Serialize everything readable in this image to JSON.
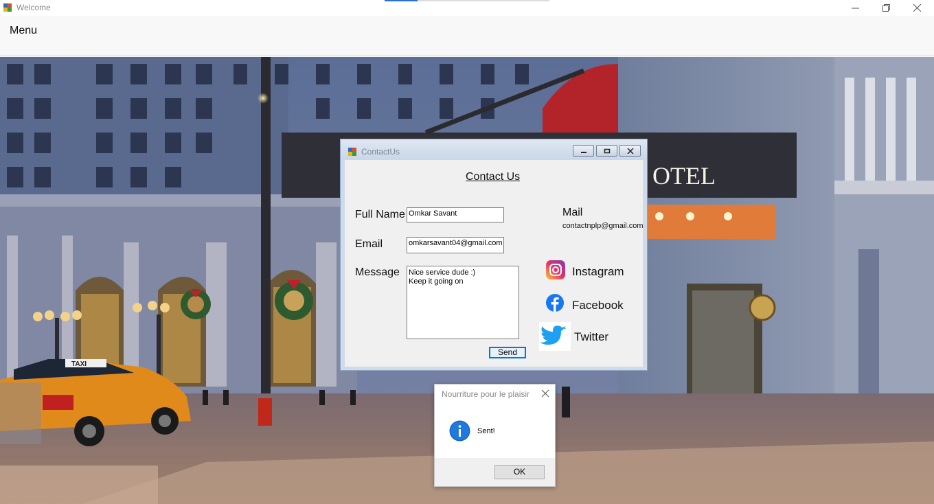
{
  "window": {
    "title": "Welcome"
  },
  "menubar": {
    "menu_label": "Menu"
  },
  "contact_window": {
    "title": "ContactUs",
    "heading": "Contact Us",
    "full_name_label": "Full Name",
    "full_name_value": "Omkar Savant",
    "email_label": "Email",
    "email_value": "omkarsavant04@gmail.com",
    "message_label": "Message",
    "message_value": "Nice service dude :)\nKeep it going on",
    "send_label": "Send",
    "mail_label": "Mail",
    "mail_address": "contactnplp@gmail.com",
    "social": {
      "instagram": "Instagram",
      "facebook": "Facebook",
      "twitter": "Twitter"
    }
  },
  "message_box": {
    "title": "Nourriture pour le plaisir",
    "text": "Sent!",
    "ok_label": "OK"
  },
  "background": {
    "sign_text": "OTEL",
    "taxi_sign": "TAXI"
  },
  "colors": {
    "accent": "#0078d7",
    "instagram": "#d6249f",
    "facebook": "#1877f2",
    "twitter": "#1da1f2"
  }
}
